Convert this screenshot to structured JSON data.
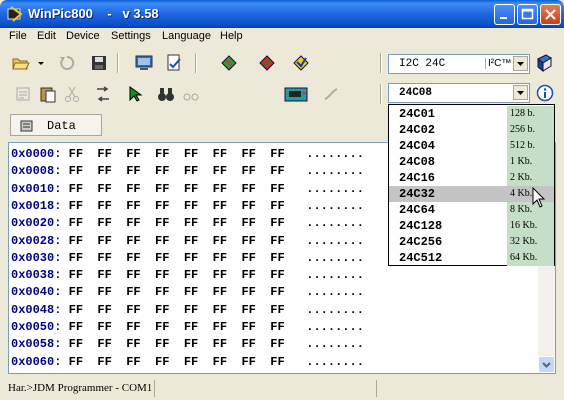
{
  "window": {
    "title": "WinPic800    -   v 3.58"
  },
  "menu": [
    "File",
    "Edit",
    "Device",
    "Settings",
    "Language",
    "Help"
  ],
  "family_combo": {
    "value": "I2C  24C",
    "chip_label": "I²C™"
  },
  "device_combo": {
    "value": "24C08"
  },
  "tab": {
    "label": "Data"
  },
  "hex_rows": [
    {
      "addr": "0x0000:",
      "bytes": "FF  FF  FF  FF  FF  FF  FF  FF",
      "ascii": "........"
    },
    {
      "addr": "0x0008:",
      "bytes": "FF  FF  FF  FF  FF  FF  FF  FF",
      "ascii": "........"
    },
    {
      "addr": "0x0010:",
      "bytes": "FF  FF  FF  FF  FF  FF  FF  FF",
      "ascii": "........"
    },
    {
      "addr": "0x0018:",
      "bytes": "FF  FF  FF  FF  FF  FF  FF  FF",
      "ascii": "........"
    },
    {
      "addr": "0x0020:",
      "bytes": "FF  FF  FF  FF  FF  FF  FF  FF",
      "ascii": "........"
    },
    {
      "addr": "0x0028:",
      "bytes": "FF  FF  FF  FF  FF  FF  FF  FF",
      "ascii": "........"
    },
    {
      "addr": "0x0030:",
      "bytes": "FF  FF  FF  FF  FF  FF  FF  FF",
      "ascii": "........"
    },
    {
      "addr": "0x0038:",
      "bytes": "FF  FF  FF  FF  FF  FF  FF  FF",
      "ascii": "........"
    },
    {
      "addr": "0x0040:",
      "bytes": "FF  FF  FF  FF  FF  FF  FF  FF",
      "ascii": "........"
    },
    {
      "addr": "0x0048:",
      "bytes": "FF  FF  FF  FF  FF  FF  FF  FF",
      "ascii": "........"
    },
    {
      "addr": "0x0050:",
      "bytes": "FF  FF  FF  FF  FF  FF  FF  FF",
      "ascii": "........"
    },
    {
      "addr": "0x0058:",
      "bytes": "FF  FF  FF  FF  FF  FF  FF  FF",
      "ascii": "........"
    },
    {
      "addr": "0x0060:",
      "bytes": "FF  FF  FF  FF  FF  FF  FF  FF",
      "ascii": "........"
    }
  ],
  "device_list": [
    {
      "name": "24C01",
      "size": "128 b."
    },
    {
      "name": "24C02",
      "size": "256 b."
    },
    {
      "name": "24C04",
      "size": "512 b."
    },
    {
      "name": "24C08",
      "size": "1 Kb."
    },
    {
      "name": "24C16",
      "size": "2 Kb."
    },
    {
      "name": "24C32",
      "size": "4 Kb.",
      "selected": true
    },
    {
      "name": "24C64",
      "size": "8 Kb."
    },
    {
      "name": "24C128",
      "size": "16 Kb."
    },
    {
      "name": "24C256",
      "size": "32 Kb."
    },
    {
      "name": "24C512",
      "size": "64 Kb."
    }
  ],
  "status": {
    "text": "Har.>JDM Programmer - COM1"
  },
  "colors": {
    "titlebar": "#0a5fd8",
    "address": "#000080",
    "size_cell": "#c5dfc7",
    "selected_row": "#c4c4c4"
  }
}
